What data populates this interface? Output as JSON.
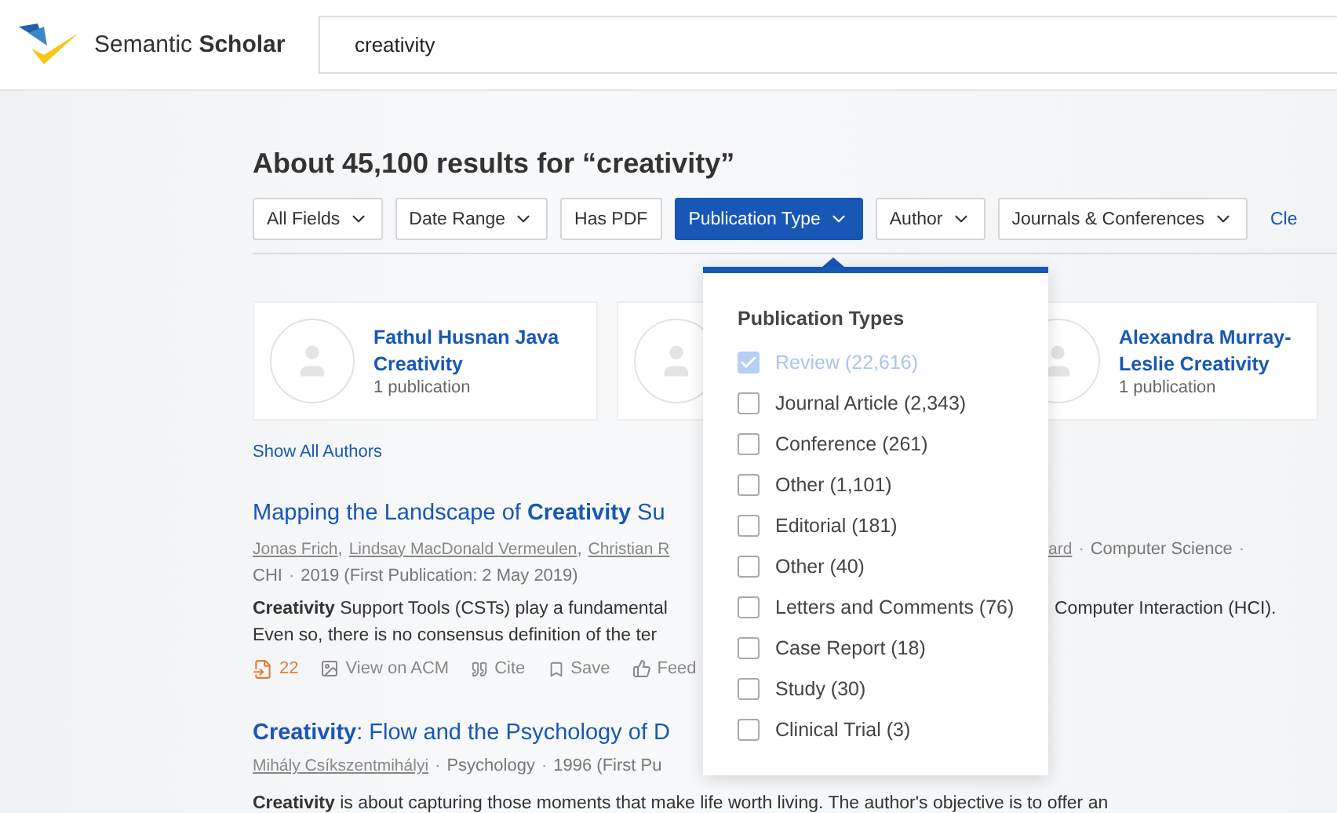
{
  "header": {
    "logo_text": "Semantic **Scholar**",
    "search": {
      "value": "creativity"
    }
  },
  "results_heading": "About 45,100 results for “creativity”",
  "filters": [
    {
      "label": "All Fields",
      "dropdown": true,
      "selected": false
    },
    {
      "label": "Date Range",
      "dropdown": true,
      "selected": false
    },
    {
      "label": "Has PDF",
      "dropdown": false,
      "selected": false
    },
    {
      "label": "Publication Type",
      "dropdown": true,
      "selected": true
    },
    {
      "label": "Author",
      "dropdown": true,
      "selected": false
    },
    {
      "label": "Journals & Conferences",
      "dropdown": true,
      "selected": false
    }
  ],
  "clear_link": "Cle",
  "authors": [
    {
      "kind": "named",
      "name": "Fathul Husnan Java Creativity",
      "count": "1 publication"
    },
    {
      "kind": "covered"
    },
    {
      "kind": "named",
      "name": "Alexandra Murray-Leslie Creativity",
      "count": "1 publication"
    }
  ],
  "show_all_authors": "Show All Authors",
  "separator": "·",
  "author_separator": ",",
  "results": [
    {
      "title": "Mapping the Landscape of **Creativity** Su",
      "authors_left": [
        "Jonas Frich",
        "Lindsay MacDonald Vermeulen",
        "Christian R"
      ],
      "authors_right": "ard",
      "field": "Computer Science",
      "venue": "CHI",
      "date": "2019 (First Publication: 2 May 2019)",
      "abstract_left": [
        "**Creativity** Support Tools (CSTs) play a fundamental",
        "Even so, there is no consensus definition of the ter"
      ],
      "abstract_right": "Computer Interaction (HCI).",
      "actions": {
        "citations": "22",
        "view": "View on ACM",
        "cite": "Cite",
        "save": "Save",
        "feed": "Feed"
      }
    },
    {
      "title": "**Creativity**: Flow and the Psychology of D",
      "authors_left": [
        "Mihály Csíkszentmihályi"
      ],
      "field": "Psychology",
      "date": "1996 (First Pu",
      "abstract_full": "**Creativity** is about capturing those moments that make life worth living. The author's objective is to offer an"
    }
  ],
  "popup": {
    "title": "Publication Types",
    "options": [
      {
        "label": "Review (22,616)",
        "checked": true
      },
      {
        "label": "Journal Article (2,343)",
        "checked": false
      },
      {
        "label": "Conference (261)",
        "checked": false
      },
      {
        "label": "Other (1,101)",
        "checked": false
      },
      {
        "label": "Editorial (181)",
        "checked": false
      },
      {
        "label": "Other (40)",
        "checked": false
      },
      {
        "label": "Letters and Comments (76)",
        "checked": false
      },
      {
        "label": "Case Report (18)",
        "checked": false
      },
      {
        "label": "Study (30)",
        "checked": false
      },
      {
        "label": "Clinical Trial (3)",
        "checked": false
      }
    ]
  }
}
